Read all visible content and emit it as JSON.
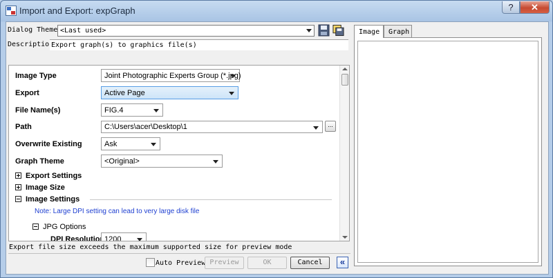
{
  "window": {
    "title": "Import and Export: expGraph",
    "help": "?",
    "close": "✕"
  },
  "header": {
    "theme_label": "Dialog Theme",
    "theme_value": "<Last used>",
    "desc_label": "Descriptio",
    "desc_value": "Export graph(s) to graphics file(s)"
  },
  "form": {
    "image_type": {
      "label": "Image Type",
      "value": "Joint Photographic Experts Group (*.jpg)"
    },
    "export": {
      "label": "Export",
      "value": "Active Page"
    },
    "file_name": {
      "label": "File Name(s)",
      "value": "FIG.4"
    },
    "path": {
      "label": "Path",
      "value": "C:\\Users\\acer\\Desktop\\1",
      "browse": "..."
    },
    "overwrite": {
      "label": "Overwrite Existing",
      "value": "Ask"
    },
    "graph_theme": {
      "label": "Graph Theme",
      "value": "<Original>"
    }
  },
  "sections": {
    "export_settings": "Export Settings",
    "image_size": "Image Size",
    "image_settings": "Image Settings",
    "note": "Note: Large DPI setting can lead to very large disk file",
    "jpg_options": "JPG Options",
    "dpi_label": "DPI Resolution",
    "dpi_value": "1200"
  },
  "status": "Export file size exceeds the maximum supported size for preview mode",
  "footer": {
    "auto_preview": "Auto Preview",
    "preview": "Preview",
    "ok": "OK",
    "cancel": "Cancel",
    "collapse": "«"
  },
  "tabs": [
    "Image",
    "Graph"
  ]
}
